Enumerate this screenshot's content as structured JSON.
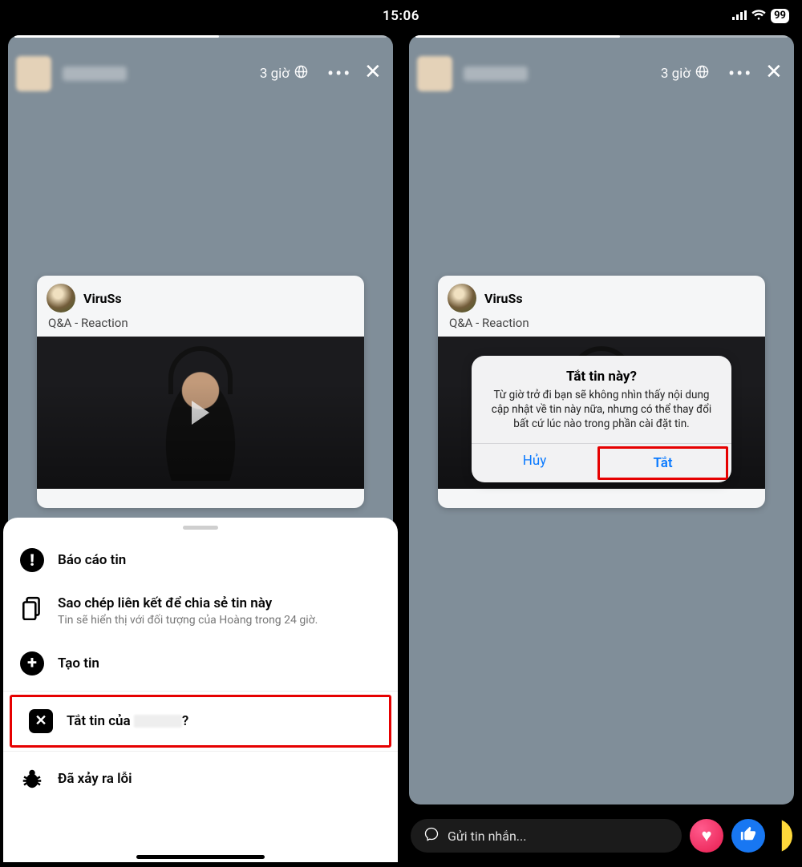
{
  "status": {
    "time": "15:06",
    "battery": "99"
  },
  "story": {
    "time_label": "3 giờ",
    "card": {
      "name": "ViruSs",
      "subtitle": "Q&A - Reaction"
    }
  },
  "sheet": {
    "report": "Báo cáo tin",
    "copy_title": "Sao chép liên kết để chia sẻ tin này",
    "copy_sub": "Tin sẽ hiển thị với đối tượng của Hoàng trong 24 giờ.",
    "create": "Tạo tin",
    "mute_prefix": "Tắt tin của ",
    "mute_suffix": "?",
    "bug": "Đã xảy ra lỗi"
  },
  "dialog": {
    "title": "Tắt tin này?",
    "body": "Từ giờ trở đi bạn sẽ không nhìn thấy nội dung cập nhật về tin này nữa, nhưng có thể thay đổi bất cứ lúc nào trong phần cài đặt tin.",
    "cancel": "Hủy",
    "confirm": "Tắt"
  },
  "reply": {
    "placeholder": "Gửi tin nhắn..."
  },
  "icons": {
    "heart": "♥",
    "globe": "🌐"
  }
}
